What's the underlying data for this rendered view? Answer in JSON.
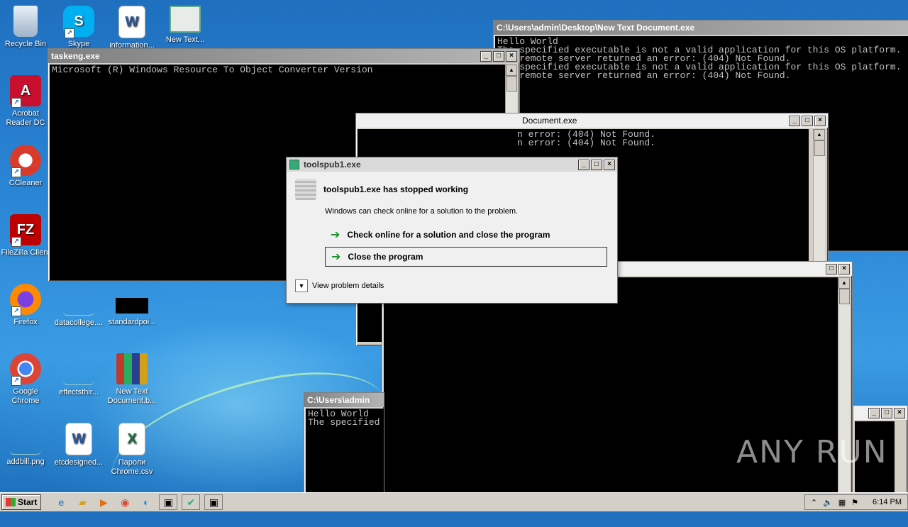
{
  "desktop": {
    "icons": [
      {
        "label": "Recycle Bin"
      },
      {
        "label": "Skype"
      },
      {
        "label": "information..."
      },
      {
        "label": "New Text..."
      },
      {
        "label": "Acrobat Reader DC"
      },
      {
        "label": "CCleaner"
      },
      {
        "label": "FileZilla Client"
      },
      {
        "label": "Firefox"
      },
      {
        "label": "datacollege...."
      },
      {
        "label": "standardpoi..."
      },
      {
        "label": "Google Chrome"
      },
      {
        "label": "effectsthir..."
      },
      {
        "label": "New Text Document.b..."
      },
      {
        "label": "addbill.png"
      },
      {
        "label": "etcdesigned..."
      },
      {
        "label": "Пароли Chrome.csv"
      }
    ]
  },
  "windows": {
    "top_right": {
      "title": "C:\\Users\\admin\\Desktop\\New Text Document.exe",
      "lines": "Hello World\nThe specified executable is not a valid application for this OS platform.\nThe remote server returned an error: (404) Not Found.\nThe specified executable is not a valid application for this OS platform.\nThe remote server returned an error: (404) Not Found."
    },
    "taskeng": {
      "title": "taskeng.exe",
      "lines": "Microsoft (R) Windows Resource To Object Converter Version"
    },
    "middle": {
      "title": "Document.exe",
      "lines": "n error: (404) Not Found.\nn error: (404) Not Found."
    },
    "bottom_small": {
      "title": "C:\\Users\\admin",
      "lines": "Hello World\nThe specified"
    }
  },
  "dialog": {
    "title": "toolspub1.exe",
    "heading": "toolspub1.exe has stopped working",
    "message": "Windows can check online for a solution to the problem.",
    "option_check": "Check online for a solution and close the program",
    "option_close": "Close the program",
    "details": "View problem details"
  },
  "taskbar": {
    "start_label": "Start",
    "clock": "6:14 PM"
  },
  "watermark": "ANY RUN"
}
